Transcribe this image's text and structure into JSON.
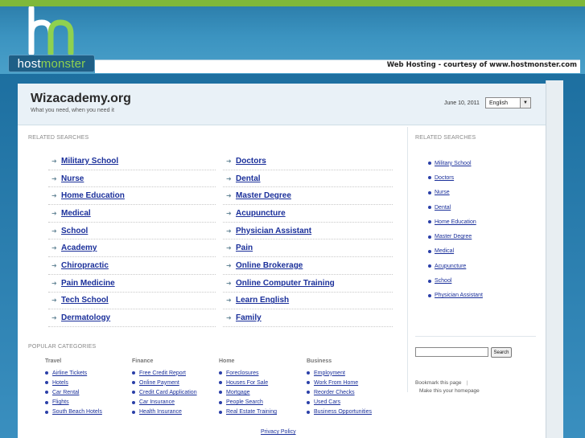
{
  "header": {
    "logo_prefix": "host",
    "logo_suffix": "monster",
    "courtesy": "Web Hosting - courtesy of www.hostmonster.com"
  },
  "site": {
    "title": "Wizacademy.org",
    "tagline": "What you need, when you need it",
    "date": "June 10, 2011",
    "language": "English"
  },
  "related_label": "RELATED SEARCHES",
  "results_left": [
    "Military School",
    "Nurse",
    "Home Education",
    "Medical",
    "School",
    "Academy",
    "Chiropractic",
    "Pain Medicine",
    "Tech School",
    "Dermatology"
  ],
  "results_right": [
    "Doctors",
    "Dental",
    "Master Degree",
    "Acupuncture",
    "Physician Assistant",
    "Pain",
    "Online Brokerage",
    "Online Computer Training",
    "Learn English",
    "Family"
  ],
  "popular_label": "POPULAR CATEGORIES",
  "popular": [
    {
      "heading": "Travel",
      "items": [
        "Airline Tickets",
        "Hotels",
        "Car Rental",
        "Flights",
        "South Beach Hotels"
      ]
    },
    {
      "heading": "Finance",
      "items": [
        "Free Credit Report",
        "Online Payment",
        "Credit Card Application",
        "Car Insurance",
        "Health Insurance"
      ]
    },
    {
      "heading": "Home",
      "items": [
        "Foreclosures",
        "Houses For Sale",
        "Mortgage",
        "People Search",
        "Real Estate Training"
      ]
    },
    {
      "heading": "Business",
      "items": [
        "Employment",
        "Work From Home",
        "Reorder Checks",
        "Used Cars",
        "Business Opportunities"
      ]
    }
  ],
  "sidebar": {
    "label": "RELATED SEARCHES",
    "items": [
      "Military School",
      "Doctors",
      "Nurse",
      "Dental",
      "Home Education",
      "Master Degree",
      "Medical",
      "Acupuncture",
      "School",
      "Physician Assistant"
    ],
    "search_button": "Search",
    "search_value": "",
    "bookmark": "Bookmark this page",
    "homepage": "Make this your homepage"
  },
  "footer": {
    "privacy": "Privacy Policy"
  },
  "colors": {
    "link": "#1a2f9a",
    "brand_green": "#7fb83a",
    "brand_blue": "#1f5f86"
  },
  "icons": {
    "result_bullet": "arrow-right-icon",
    "list_bullet": "dot-icon",
    "dropdown": "triangle-down-icon"
  }
}
